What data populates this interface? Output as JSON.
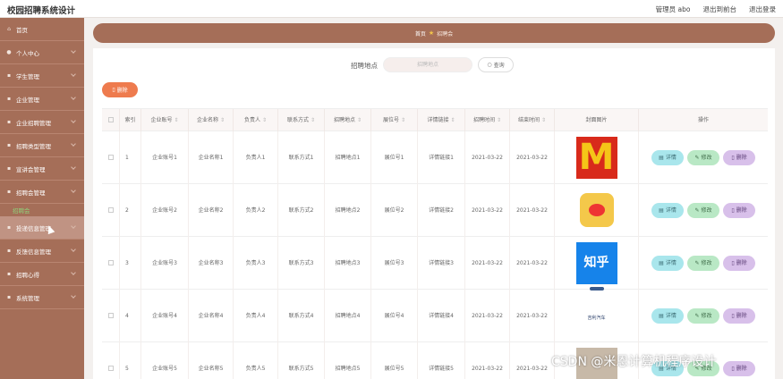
{
  "app": {
    "title": "校园招聘系统设计"
  },
  "top_links": [
    "管理员 abo",
    "退出到前台",
    "退出登录"
  ],
  "sidebar": {
    "items": [
      {
        "label": "首页",
        "icon": "home-icon"
      },
      {
        "label": "个人中心",
        "icon": "user-icon"
      },
      {
        "label": "学生管理",
        "icon": "menu-icon"
      },
      {
        "label": "企业管理",
        "icon": "menu-icon"
      },
      {
        "label": "企业招聘管理",
        "icon": "menu-icon"
      },
      {
        "label": "招聘类型管理",
        "icon": "menu-icon"
      },
      {
        "label": "宣讲会管理",
        "icon": "menu-icon"
      },
      {
        "label": "招聘会管理",
        "icon": "menu-icon"
      },
      {
        "label": "投递信息管理",
        "icon": "menu-icon"
      },
      {
        "label": "反馈信息管理",
        "icon": "menu-icon"
      },
      {
        "label": "招聘心得",
        "icon": "menu-icon"
      },
      {
        "label": "系统管理",
        "icon": "menu-icon"
      }
    ],
    "active_sub": "招聘会"
  },
  "breadcrumb": {
    "home": "首页",
    "current": "招聘会"
  },
  "search": {
    "label": "招聘地点",
    "placeholder": "招聘地点",
    "button": "查询"
  },
  "actions": {
    "delete": "删除"
  },
  "table": {
    "headers": [
      "索引",
      "企业账号",
      "企业名称",
      "负责人",
      "联系方式",
      "招聘地点",
      "展位号",
      "详情链接",
      "招聘时间",
      "结束时间",
      "封面图片",
      "操作"
    ],
    "rows": [
      {
        "index": "1",
        "account": "企业账号1",
        "name": "企业名称1",
        "owner": "负责人1",
        "contact": "联系方式1",
        "location": "招聘地点1",
        "booth": "展位号1",
        "link": "详情链接1",
        "start": "2021-03-22",
        "end": "2021-03-22",
        "logo": "mcdonalds"
      },
      {
        "index": "2",
        "account": "企业账号2",
        "name": "企业名称2",
        "owner": "负责人2",
        "contact": "联系方式2",
        "location": "招聘地点2",
        "booth": "展位号2",
        "link": "详情链接2",
        "start": "2021-03-22",
        "end": "2021-03-22",
        "logo": "weibo"
      },
      {
        "index": "3",
        "account": "企业账号3",
        "name": "企业名称3",
        "owner": "负责人3",
        "contact": "联系方式3",
        "location": "招聘地点3",
        "booth": "展位号3",
        "link": "详情链接3",
        "start": "2021-03-22",
        "end": "2021-03-22",
        "logo": "zhihu"
      },
      {
        "index": "4",
        "account": "企业账号4",
        "name": "企业名称4",
        "owner": "负责人4",
        "contact": "联系方式4",
        "location": "招聘地点4",
        "booth": "展位号4",
        "link": "详情链接4",
        "start": "2021-03-22",
        "end": "2021-03-22",
        "logo": "geely"
      },
      {
        "index": "5",
        "account": "企业账号5",
        "name": "企业名称5",
        "owner": "负责人5",
        "contact": "联系方式5",
        "location": "招聘地点5",
        "booth": "展位号5",
        "link": "详情链接5",
        "start": "2021-03-22",
        "end": "2021-03-22",
        "logo": "photo"
      }
    ],
    "row_actions": {
      "detail": "详情",
      "edit": "修改",
      "delete": "删除"
    },
    "logo_text": {
      "mcdonalds": "M",
      "zhihu": "知乎",
      "geely": "吉利汽车"
    }
  },
  "watermark": "CSDN @米恩计算机程序设计",
  "colors": {
    "sidebar": "#a56e58",
    "accent_orange": "#ee7b4e",
    "detail": "#a9e6ec",
    "edit": "#b9e8c5",
    "delete": "#d8c0ea"
  }
}
